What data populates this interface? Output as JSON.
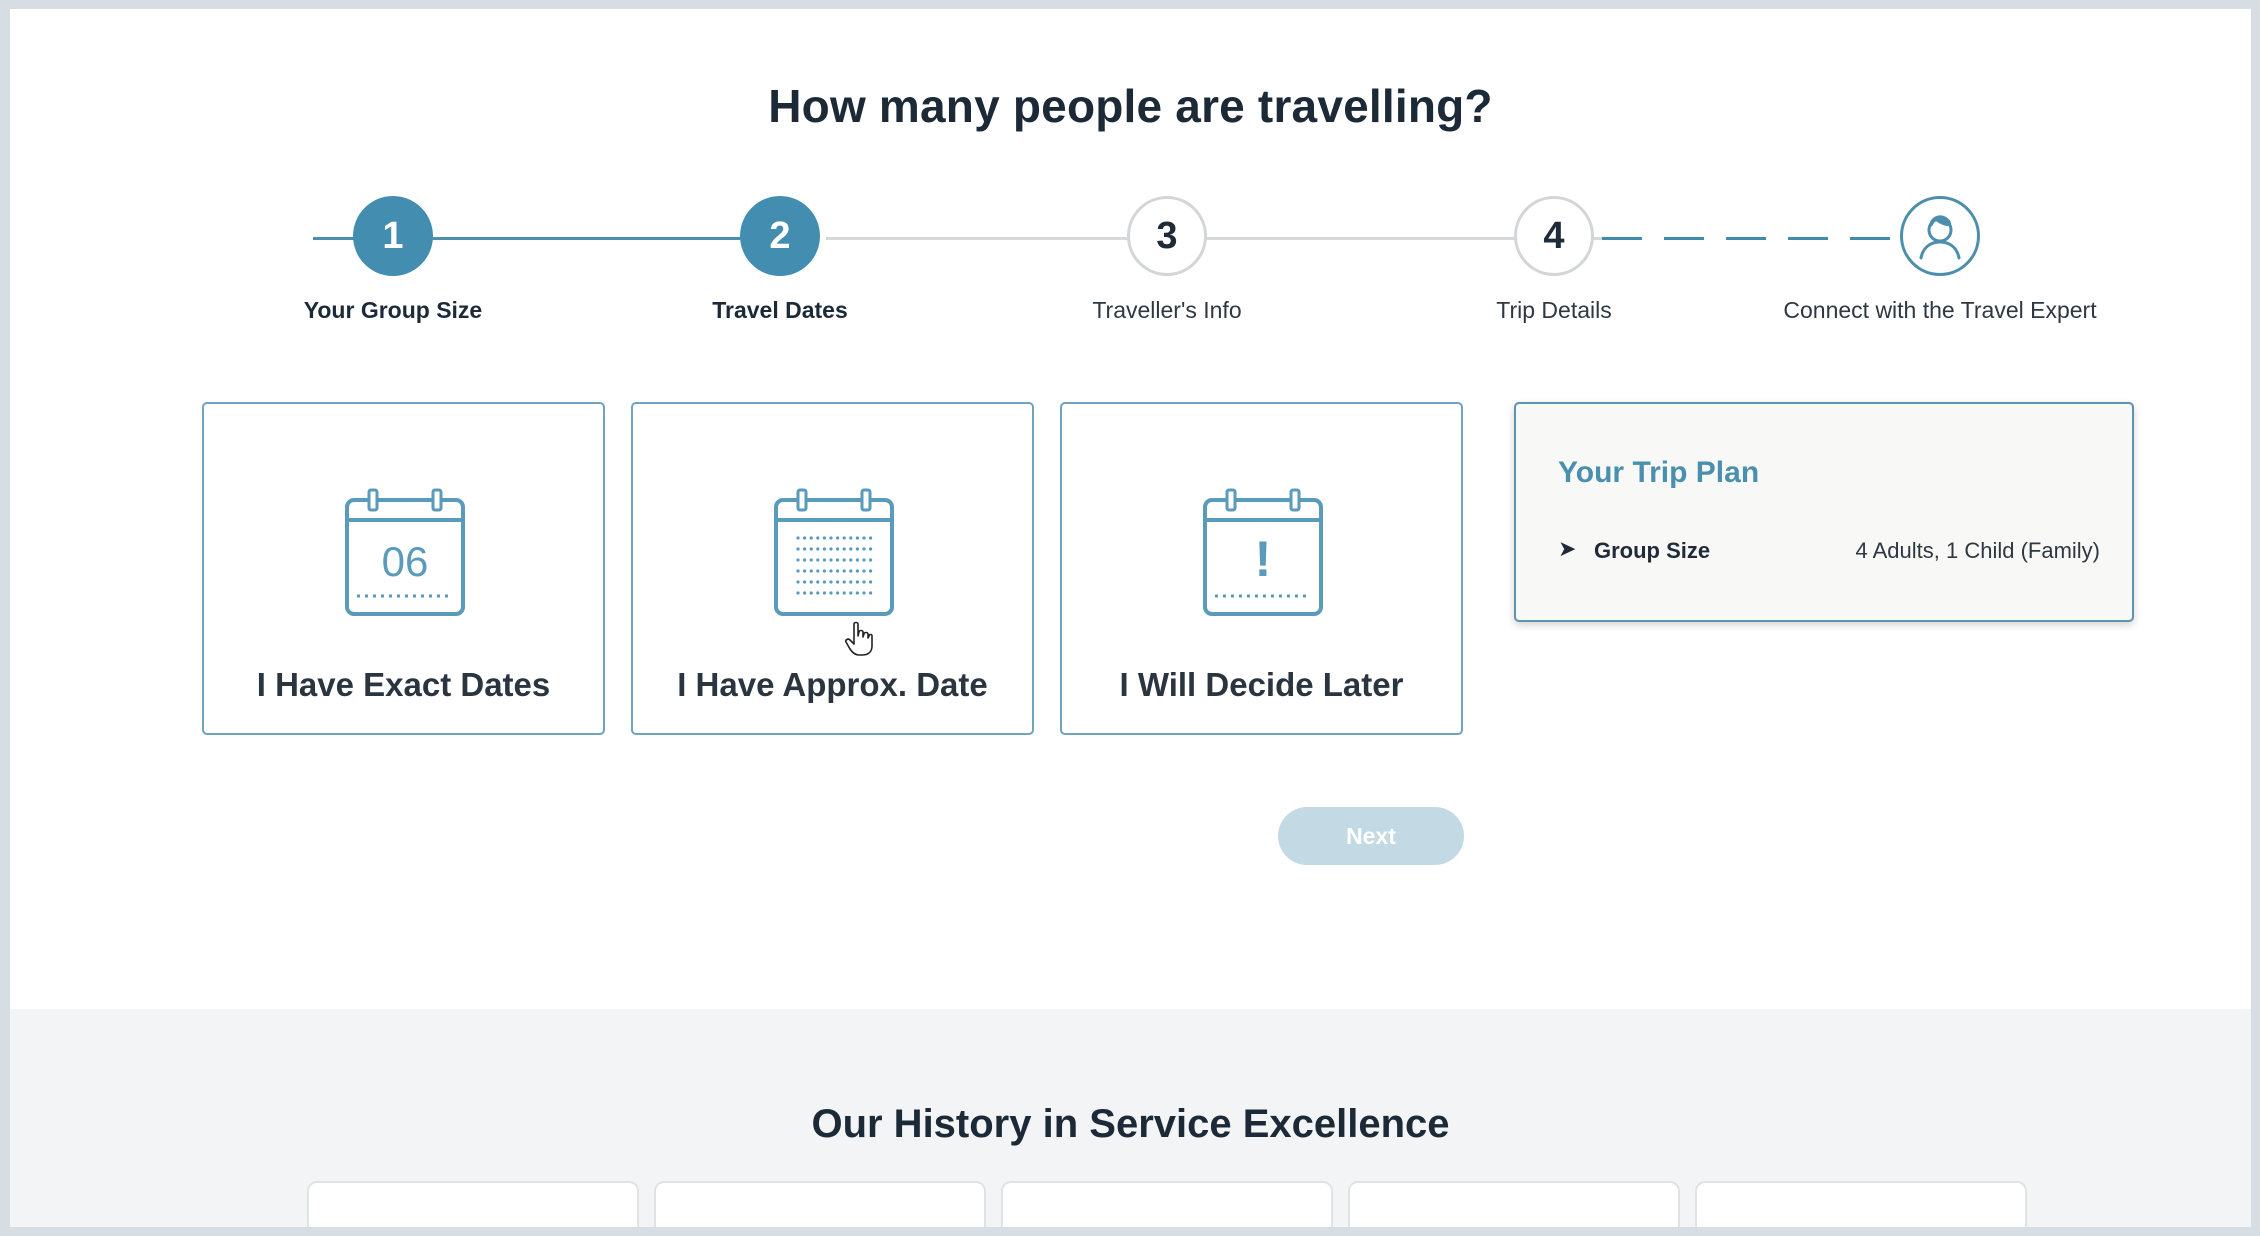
{
  "page": {
    "title": "How many people are travelling?"
  },
  "stepper": {
    "steps": [
      {
        "number": "1",
        "label": "Your Group Size",
        "state": "completed"
      },
      {
        "number": "2",
        "label": "Travel Dates",
        "state": "current"
      },
      {
        "number": "3",
        "label": "Traveller's Info",
        "state": "upcoming"
      },
      {
        "number": "4",
        "label": "Trip Details",
        "state": "upcoming"
      },
      {
        "number": "",
        "label": "Connect with the Travel Expert",
        "state": "upcoming",
        "icon": "person-avatar-icon"
      }
    ]
  },
  "options": {
    "exact": {
      "label": "I Have Exact Dates",
      "icon_text": "06",
      "icon": "calendar-date-icon"
    },
    "approx": {
      "label": "I Have Approx. Date",
      "icon": "calendar-grid-icon"
    },
    "later": {
      "label": "I Will Decide Later",
      "icon_text": "!",
      "icon": "calendar-exclamation-icon"
    }
  },
  "trip_plan": {
    "title": "Your Trip Plan",
    "rows": [
      {
        "key": "Group Size",
        "value": "4 Adults, 1 Child (Family)"
      }
    ]
  },
  "actions": {
    "next_label": "Next",
    "next_disabled": true
  },
  "history": {
    "title": "Our History in Service Excellence"
  },
  "colors": {
    "accent": "#438eb0",
    "card_border": "#6ea4be",
    "text_dark": "#1c2a38",
    "next_disabled_bg": "#c3dae5"
  }
}
